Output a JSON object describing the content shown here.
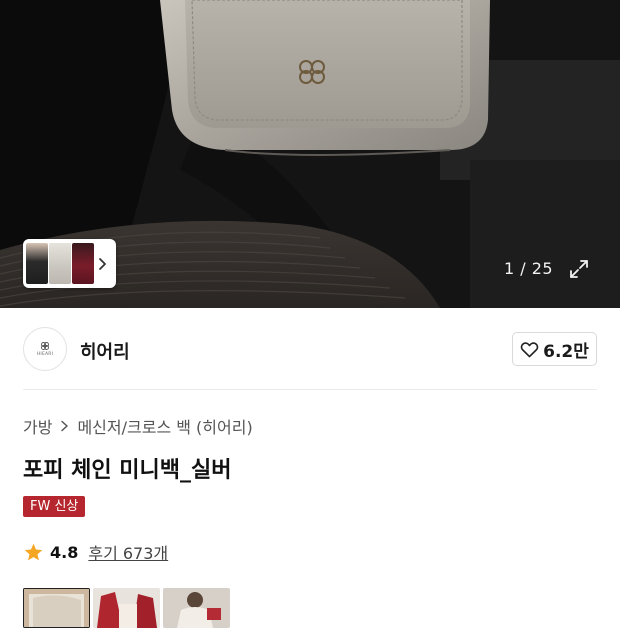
{
  "gallery": {
    "counter": "1 / 25"
  },
  "brand": {
    "name": "히어리",
    "logo_text": "HIEARI",
    "likes": "6.2만"
  },
  "breadcrumb": {
    "items": [
      "가방",
      "메신저/크로스 백 (히어리)"
    ]
  },
  "product": {
    "title": "포피 체인 미니백_실버",
    "badge": "FW 신상",
    "rating": "4.8",
    "reviews": "후기 673개"
  },
  "colors": {
    "badge": "#b5262e",
    "star": "#f5a623"
  },
  "icons": [
    "chevron-right-icon",
    "expand-icon",
    "heart-icon",
    "star-icon"
  ]
}
